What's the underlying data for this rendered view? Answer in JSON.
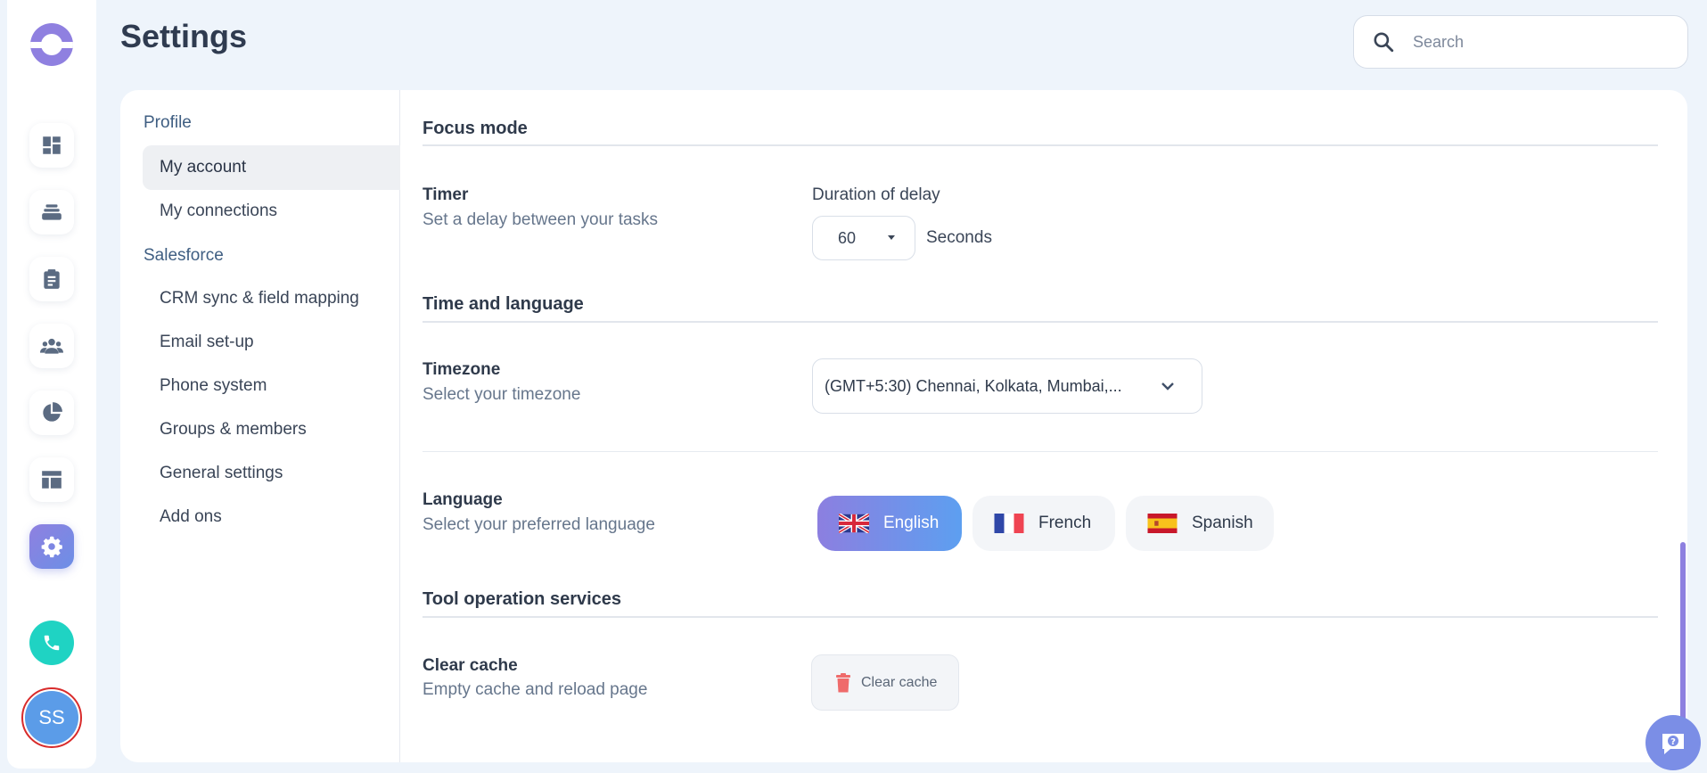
{
  "app": {
    "page_title": "Settings"
  },
  "search": {
    "placeholder": "Search",
    "value": ""
  },
  "rail": {
    "items": [
      {
        "icon": "dashboard-icon",
        "active": false
      },
      {
        "icon": "stack-icon",
        "active": false
      },
      {
        "icon": "clipboard-icon",
        "active": false
      },
      {
        "icon": "team-icon",
        "active": false
      },
      {
        "icon": "pie-chart-icon",
        "active": false
      },
      {
        "icon": "layout-icon",
        "active": false
      },
      {
        "icon": "gear-icon",
        "active": true
      }
    ],
    "phone_icon": "phone-icon",
    "avatar_initials": "SS"
  },
  "subnav": {
    "groups": [
      {
        "label": "Profile",
        "items": [
          {
            "label": "My account",
            "active": true
          },
          {
            "label": "My connections",
            "active": false
          }
        ]
      },
      {
        "label": "Salesforce",
        "items": [
          {
            "label": "CRM sync & field mapping",
            "active": false
          },
          {
            "label": "Email set-up",
            "active": false
          },
          {
            "label": "Phone system",
            "active": false
          },
          {
            "label": "Groups & members",
            "active": false
          },
          {
            "label": "General settings",
            "active": false
          },
          {
            "label": "Add ons",
            "active": false
          }
        ]
      }
    ]
  },
  "focus_mode": {
    "section_title": "Focus mode",
    "timer": {
      "title": "Timer",
      "description": "Set a delay between your tasks",
      "delay_label": "Duration of delay",
      "delay_value": "60",
      "unit": "Seconds"
    }
  },
  "time_language": {
    "section_title": "Time and language",
    "timezone": {
      "title": "Timezone",
      "description": "Select your timezone",
      "value": "(GMT+5:30) Chennai, Kolkata, Mumbai,..."
    },
    "language": {
      "title": "Language",
      "description": "Select your preferred language",
      "options": [
        {
          "label": "English",
          "flag": "uk-flag-icon",
          "selected": true
        },
        {
          "label": "French",
          "flag": "france-flag-icon",
          "selected": false
        },
        {
          "label": "Spanish",
          "flag": "spain-flag-icon",
          "selected": false
        }
      ]
    }
  },
  "tool_operation": {
    "section_title": "Tool operation services",
    "clear_cache": {
      "title": "Clear cache",
      "description": "Empty cache and reload page",
      "button_label": "Clear cache"
    }
  },
  "colors": {
    "accent": "#8f80e0",
    "accent_blue": "#5d9ff0",
    "phone": "#1fd3c3",
    "avatar": "#5b9ce8",
    "danger": "#ef6b6b"
  }
}
